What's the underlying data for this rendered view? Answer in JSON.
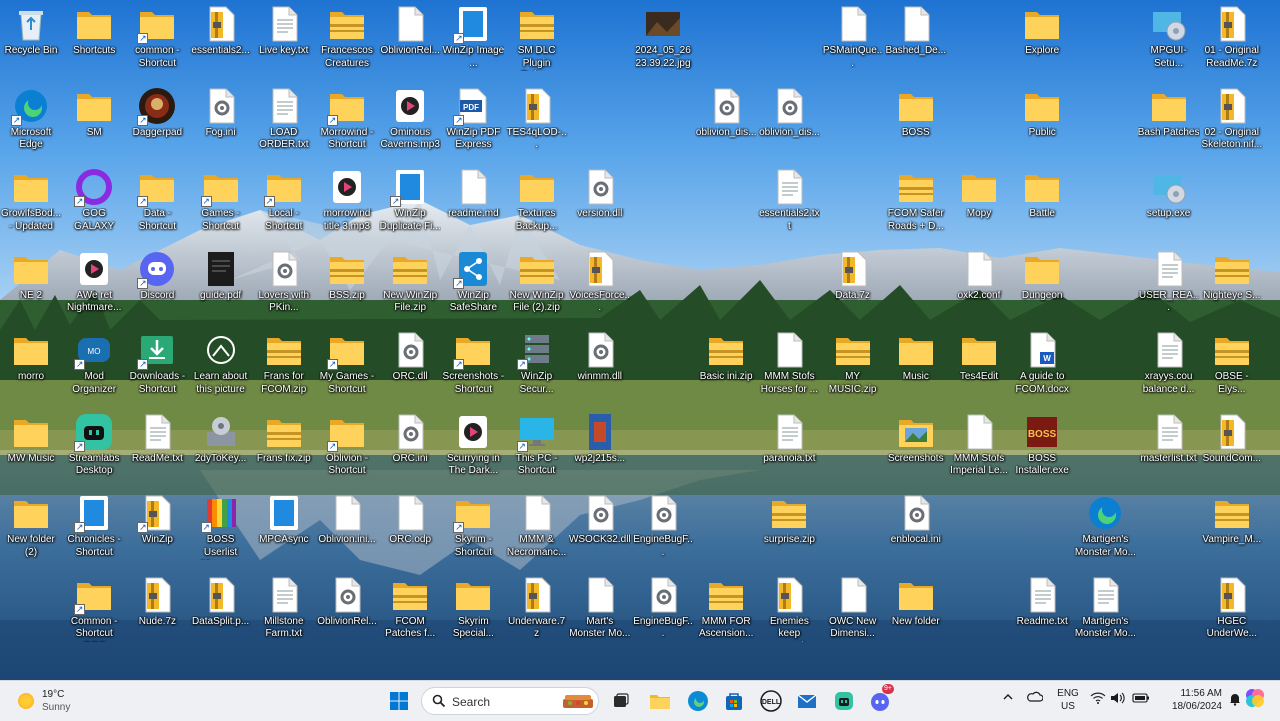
{
  "desktop": {
    "icons": [
      {
        "label": "Recycle Bin",
        "type": "bin",
        "col": 0,
        "row": 0
      },
      {
        "label": "Shortcuts",
        "type": "folder",
        "col": 1,
        "row": 0
      },
      {
        "label": "common - Shortcut",
        "type": "folder",
        "col": 2,
        "row": 0,
        "sc": true
      },
      {
        "label": "essentials2...",
        "type": "zip",
        "col": 3,
        "row": 0
      },
      {
        "label": "Live key.txt",
        "type": "txt",
        "col": 4,
        "row": 0
      },
      {
        "label": "Francescos Creatures an...",
        "type": "folderz",
        "col": 5,
        "row": 0
      },
      {
        "label": "OblivionRel...",
        "type": "file",
        "col": 6,
        "row": 0
      },
      {
        "label": "WinZip Image ...",
        "type": "app-blue",
        "col": 7,
        "row": 0,
        "sc": true
      },
      {
        "label": "SM DLC Plugin Refur...",
        "type": "folderz",
        "col": 8,
        "row": 0
      },
      {
        "label": "2024_05_26 23.39.22.jpg",
        "type": "img",
        "col": 10,
        "row": 0
      },
      {
        "label": "PSMainQue...",
        "type": "file",
        "col": 13,
        "row": 0
      },
      {
        "label": "Bashed_De...",
        "type": "file",
        "col": 14,
        "row": 0
      },
      {
        "label": "Explore",
        "type": "folder",
        "col": 16,
        "row": 0
      },
      {
        "label": "MPGUI-Setu...",
        "type": "setup",
        "col": 18,
        "row": 0
      },
      {
        "label": "01 - Original ReadMe.7z",
        "type": "zip",
        "col": 19,
        "row": 0
      },
      {
        "label": "Microsoft Edge",
        "type": "edge",
        "col": 0,
        "row": 1,
        "sc": true
      },
      {
        "label": "SM",
        "type": "folder",
        "col": 1,
        "row": 1
      },
      {
        "label": "Daggerpad",
        "type": "dagger",
        "col": 2,
        "row": 1,
        "sc": true
      },
      {
        "label": "Fog.ini",
        "type": "ini",
        "col": 3,
        "row": 1
      },
      {
        "label": "LOAD ORDER.txt",
        "type": "txt",
        "col": 4,
        "row": 1
      },
      {
        "label": "Morrowind - Shortcut",
        "type": "folder",
        "col": 5,
        "row": 1,
        "sc": true
      },
      {
        "label": "Ominous Caverns.mp3",
        "type": "media",
        "col": 6,
        "row": 1
      },
      {
        "label": "WinZip PDF Express",
        "type": "pdf",
        "col": 7,
        "row": 1,
        "sc": true
      },
      {
        "label": "TES4qLOD-...",
        "type": "zip",
        "col": 8,
        "row": 1
      },
      {
        "label": "oblivion_dis...",
        "type": "ini",
        "col": 11,
        "row": 1
      },
      {
        "label": "oblivion_dis...",
        "type": "ini",
        "col": 12,
        "row": 1
      },
      {
        "label": "BOSS",
        "type": "folder",
        "col": 14,
        "row": 1
      },
      {
        "label": "Public",
        "type": "folder",
        "col": 16,
        "row": 1
      },
      {
        "label": "Bash Patches",
        "type": "folder",
        "col": 18,
        "row": 1
      },
      {
        "label": "02 - Original Skeleton.nif...",
        "type": "zip",
        "col": 19,
        "row": 1
      },
      {
        "label": "GrowlfsBod... - Updated",
        "type": "folder",
        "col": 0,
        "row": 2
      },
      {
        "label": "GOG GALAXY",
        "type": "gog",
        "col": 1,
        "row": 2,
        "sc": true
      },
      {
        "label": "Data - Shortcut",
        "type": "folder",
        "col": 2,
        "row": 2,
        "sc": true
      },
      {
        "label": "Games - Shortcut",
        "type": "folder",
        "col": 3,
        "row": 2,
        "sc": true
      },
      {
        "label": "Local - Shortcut",
        "type": "folder",
        "col": 4,
        "row": 2,
        "sc": true
      },
      {
        "label": "morrowind title 3.mp3",
        "type": "media",
        "col": 5,
        "row": 2
      },
      {
        "label": "WinZip Duplicate Fi...",
        "type": "app-blue",
        "col": 6,
        "row": 2,
        "sc": true
      },
      {
        "label": "readme.md",
        "type": "file",
        "col": 7,
        "row": 2
      },
      {
        "label": "Textures Backup...",
        "type": "folder",
        "col": 8,
        "row": 2
      },
      {
        "label": "version.dll",
        "type": "ini",
        "col": 9,
        "row": 2
      },
      {
        "label": "essentials2.txt",
        "type": "txt",
        "col": 12,
        "row": 2
      },
      {
        "label": "FCOM Safer Roads + D...",
        "type": "folderz",
        "col": 14,
        "row": 2
      },
      {
        "label": "Mopy",
        "type": "folder",
        "col": 15,
        "row": 2
      },
      {
        "label": "Battle",
        "type": "folder",
        "col": 16,
        "row": 2
      },
      {
        "label": "setup.exe",
        "type": "setup",
        "col": 18,
        "row": 2
      },
      {
        "label": "NE 2",
        "type": "folder",
        "col": 0,
        "row": 3
      },
      {
        "label": "AWe ret Nightmare...",
        "type": "media",
        "col": 1,
        "row": 3
      },
      {
        "label": "Discord",
        "type": "discord",
        "col": 2,
        "row": 3,
        "sc": true
      },
      {
        "label": "guide.pdf",
        "type": "dark",
        "col": 3,
        "row": 3
      },
      {
        "label": "Lovers with PKin...",
        "type": "ini",
        "col": 4,
        "row": 3
      },
      {
        "label": "BSS.zip",
        "type": "folderz",
        "col": 5,
        "row": 3
      },
      {
        "label": "New WinZip File.zip",
        "type": "folderz",
        "col": 6,
        "row": 3
      },
      {
        "label": "WinZip SafeShare",
        "type": "share",
        "col": 7,
        "row": 3,
        "sc": true
      },
      {
        "label": "New WinZip File (2).zip",
        "type": "folderz",
        "col": 8,
        "row": 3
      },
      {
        "label": "VoicesForce...",
        "type": "zip",
        "col": 9,
        "row": 3
      },
      {
        "label": "Data.7z",
        "type": "zip",
        "col": 13,
        "row": 3
      },
      {
        "label": "oxk2.conf",
        "type": "file",
        "col": 15,
        "row": 3
      },
      {
        "label": "Dungeon",
        "type": "folder",
        "col": 16,
        "row": 3
      },
      {
        "label": "USER_REA...",
        "type": "txt",
        "col": 18,
        "row": 3
      },
      {
        "label": "Nighteye S...",
        "type": "folderz",
        "col": 19,
        "row": 3
      },
      {
        "label": "morro",
        "type": "folder",
        "col": 0,
        "row": 4
      },
      {
        "label": "Mod Organizer",
        "type": "mo",
        "col": 1,
        "row": 4,
        "sc": true
      },
      {
        "label": "Downloads - Shortcut",
        "type": "download",
        "col": 2,
        "row": 4,
        "sc": true
      },
      {
        "label": "Learn about this picture",
        "type": "learn",
        "col": 3,
        "row": 4
      },
      {
        "label": "Frans for FCOM.zip",
        "type": "folderz",
        "col": 4,
        "row": 4
      },
      {
        "label": "My Games - Shortcut",
        "type": "folder",
        "col": 5,
        "row": 4,
        "sc": true
      },
      {
        "label": "ORC.dll",
        "type": "ini",
        "col": 6,
        "row": 4
      },
      {
        "label": "Screenshots - Shortcut",
        "type": "folder",
        "col": 7,
        "row": 4,
        "sc": true
      },
      {
        "label": "WinZip Secur...",
        "type": "server",
        "col": 8,
        "row": 4,
        "sc": true
      },
      {
        "label": "winmm.dll",
        "type": "ini",
        "col": 9,
        "row": 4
      },
      {
        "label": "Basic ini.zip",
        "type": "folderz",
        "col": 11,
        "row": 4
      },
      {
        "label": "MMM Stofs Horses for ...",
        "type": "file",
        "col": 12,
        "row": 4
      },
      {
        "label": "MY MUSIC.zip",
        "type": "folderz",
        "col": 13,
        "row": 4
      },
      {
        "label": "Music",
        "type": "folder",
        "col": 14,
        "row": 4
      },
      {
        "label": "Tes4Edit",
        "type": "folder",
        "col": 15,
        "row": 4
      },
      {
        "label": "A guide to FCOM.docx",
        "type": "docx",
        "col": 16,
        "row": 4
      },
      {
        "label": "xrayys.cou balance d...",
        "type": "txt",
        "col": 18,
        "row": 4
      },
      {
        "label": "OBSE - Elys...",
        "type": "folderz",
        "col": 19,
        "row": 4
      },
      {
        "label": "MW Music",
        "type": "folder",
        "col": 0,
        "row": 5
      },
      {
        "label": "Streamlabs Desktop",
        "type": "streamlabs",
        "col": 1,
        "row": 5,
        "sc": true
      },
      {
        "label": "ReadMe.txt",
        "type": "txt",
        "col": 2,
        "row": 5
      },
      {
        "label": "2dyToKey...",
        "type": "tool",
        "col": 3,
        "row": 5
      },
      {
        "label": "Frans fix.zip",
        "type": "folderz",
        "col": 4,
        "row": 5
      },
      {
        "label": "Oblivion - Shortcut",
        "type": "folder",
        "col": 5,
        "row": 5,
        "sc": true
      },
      {
        "label": "ORC.ini",
        "type": "ini",
        "col": 6,
        "row": 5
      },
      {
        "label": "Scurrying in The Dark...",
        "type": "media",
        "col": 7,
        "row": 5
      },
      {
        "label": "This PC - Shortcut",
        "type": "monitor",
        "col": 8,
        "row": 5,
        "sc": true
      },
      {
        "label": "wp2j215s...",
        "type": "imgblue",
        "col": 9,
        "row": 5
      },
      {
        "label": "paranoia.txt",
        "type": "txt",
        "col": 12,
        "row": 5
      },
      {
        "label": "Screenshots",
        "type": "folderimg",
        "col": 14,
        "row": 5
      },
      {
        "label": "MMM Stofs Imperial Le...",
        "type": "file",
        "col": 15,
        "row": 5
      },
      {
        "label": "BOSS Installer.exe",
        "type": "boss",
        "col": 16,
        "row": 5
      },
      {
        "label": "masterlist.txt",
        "type": "txt",
        "col": 18,
        "row": 5
      },
      {
        "label": "SoundCom...",
        "type": "zip",
        "col": 19,
        "row": 5
      },
      {
        "label": "New folder (2)",
        "type": "folder",
        "col": 0,
        "row": 6
      },
      {
        "label": "Chronicles - Shortcut",
        "type": "app-blue",
        "col": 1,
        "row": 6,
        "sc": true
      },
      {
        "label": "WinZip",
        "type": "zip",
        "col": 2,
        "row": 6,
        "sc": true
      },
      {
        "label": "BOSS Userlist Manager",
        "type": "bossum",
        "col": 3,
        "row": 6,
        "sc": true
      },
      {
        "label": "MPCAsync",
        "type": "app-blue",
        "col": 4,
        "row": 6
      },
      {
        "label": "Oblivion.ini...",
        "type": "file",
        "col": 5,
        "row": 6
      },
      {
        "label": "ORC.odp",
        "type": "file",
        "col": 6,
        "row": 6
      },
      {
        "label": "Skyrim - Shortcut",
        "type": "folder",
        "col": 7,
        "row": 6,
        "sc": true
      },
      {
        "label": "MMM & Necromanc...",
        "type": "file",
        "col": 8,
        "row": 6
      },
      {
        "label": "WSOCK32.dll",
        "type": "ini",
        "col": 9,
        "row": 6
      },
      {
        "label": "EngineBugF...",
        "type": "ini",
        "col": 10,
        "row": 6
      },
      {
        "label": "surprise.zip",
        "type": "folderz",
        "col": 12,
        "row": 6
      },
      {
        "label": "enblocal.ini",
        "type": "ini",
        "col": 14,
        "row": 6
      },
      {
        "label": "Martigen's Monster Mo...",
        "type": "edge",
        "col": 17,
        "row": 6
      },
      {
        "label": "Vampire_M...",
        "type": "folderz",
        "col": 19,
        "row": 6
      },
      {
        "label": "Common - Shortcut GOG",
        "type": "folder",
        "col": 1,
        "row": 7,
        "sc": true
      },
      {
        "label": "Nude.7z",
        "type": "zip",
        "col": 2,
        "row": 7
      },
      {
        "label": "DataSplit.p...",
        "type": "zip",
        "col": 3,
        "row": 7
      },
      {
        "label": "Millstone Farm.txt",
        "type": "txt",
        "col": 4,
        "row": 7
      },
      {
        "label": "OblivionRel...",
        "type": "ini",
        "col": 5,
        "row": 7
      },
      {
        "label": "FCOM Patches f...",
        "type": "folderz",
        "col": 6,
        "row": 7
      },
      {
        "label": "Skyrim Special...",
        "type": "folder",
        "col": 7,
        "row": 7
      },
      {
        "label": "Underware.7z",
        "type": "zip",
        "col": 8,
        "row": 7
      },
      {
        "label": "Mart's Monster Mo...",
        "type": "file",
        "col": 9,
        "row": 7
      },
      {
        "label": "EngineBugF...",
        "type": "ini",
        "col": 10,
        "row": 7
      },
      {
        "label": "MMM FOR Ascension...",
        "type": "folderz",
        "col": 11,
        "row": 7
      },
      {
        "label": "Enemies keep weapons in ...",
        "type": "zip",
        "col": 12,
        "row": 7
      },
      {
        "label": "OWC New Dimensi...",
        "type": "file",
        "col": 13,
        "row": 7
      },
      {
        "label": "New folder",
        "type": "folder",
        "col": 14,
        "row": 7
      },
      {
        "label": "Readme.txt",
        "type": "txt",
        "col": 16,
        "row": 7
      },
      {
        "label": "Martigen's Monster Mo...",
        "type": "txt",
        "col": 17,
        "row": 7
      },
      {
        "label": "HGEC UnderWe...",
        "type": "zip",
        "col": 19,
        "row": 7
      }
    ]
  },
  "taskbar": {
    "weather": {
      "temp": "19°C",
      "condition": "Sunny"
    },
    "search_placeholder": "Search",
    "apps": [
      {
        "name": "start-button",
        "icon": "windows-icon"
      },
      {
        "name": "task-view-button",
        "icon": "task-view-icon"
      },
      {
        "name": "file-explorer-button",
        "icon": "folder-icon"
      },
      {
        "name": "edge-taskbar-button",
        "icon": "edge-icon"
      },
      {
        "name": "store-button",
        "icon": "store-icon"
      },
      {
        "name": "dell-button",
        "icon": "dell-icon"
      },
      {
        "name": "mail-button",
        "icon": "mail-icon"
      },
      {
        "name": "streamlabs-taskbar-button",
        "icon": "streamlabs-icon"
      },
      {
        "name": "discord-taskbar-button",
        "icon": "discord-icon"
      }
    ],
    "discord_badge": "9+",
    "language": {
      "line1": "ENG",
      "line2": "US"
    },
    "clock": {
      "time": "11:56 AM",
      "date": "18/06/2024"
    },
    "colors": {
      "accent": "#0067c0",
      "folder": "#f5c342",
      "taskbar_bg": "#eef0f4"
    }
  }
}
